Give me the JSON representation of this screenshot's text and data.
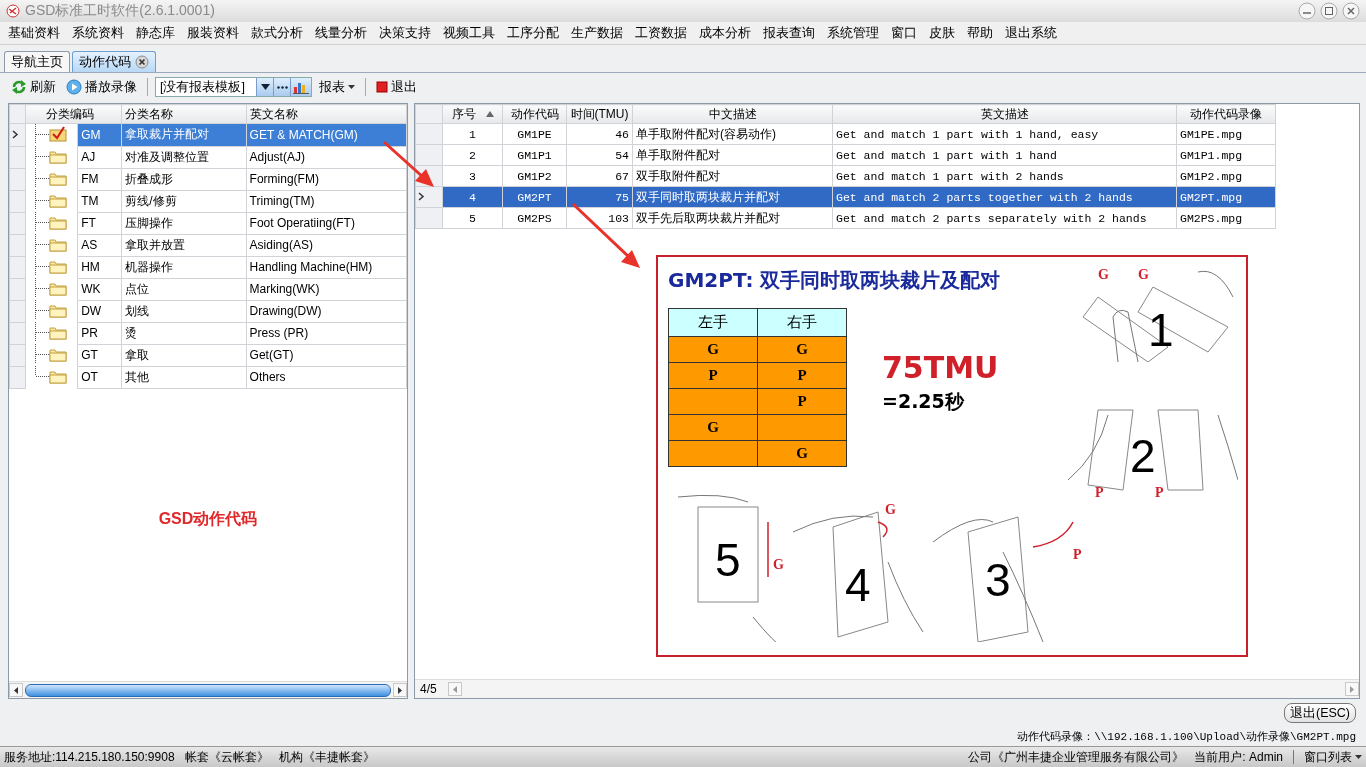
{
  "window": {
    "title": "GSD标准工时软件(2.6.1.0001)"
  },
  "menu": [
    "基础资料",
    "系统资料",
    "静态库",
    "服装资料",
    "款式分析",
    "线量分析",
    "决策支持",
    "视频工具",
    "工序分配",
    "生产数据",
    "工资数据",
    "成本分析",
    "报表查询",
    "系统管理",
    "窗口",
    "皮肤",
    "帮助",
    "退出系统"
  ],
  "tabs": [
    {
      "label": "导航主页",
      "selected": false,
      "closable": false
    },
    {
      "label": "动作代码",
      "selected": true,
      "closable": true
    }
  ],
  "toolbar": {
    "refresh": "刷新",
    "play": "播放录像",
    "template_combo": {
      "value": "[没有报表模板]"
    },
    "report_menu": "报表",
    "exit": "退出"
  },
  "category_grid": {
    "columns": [
      "分类编码",
      "分类名称",
      "英文名称"
    ],
    "rows": [
      {
        "kind": "checked",
        "code": "GM",
        "name": "拿取裁片并配对",
        "english": "GET & MATCH(GM)",
        "selected": true
      },
      {
        "kind": "folder",
        "code": "AJ",
        "name": "对准及调整位置",
        "english": "Adjust(AJ)",
        "selected": false
      },
      {
        "kind": "folder",
        "code": "FM",
        "name": "折叠成形",
        "english": "Forming(FM)",
        "selected": false
      },
      {
        "kind": "folder",
        "code": "TM",
        "name": "剪线/修剪",
        "english": "Triming(TM)",
        "selected": false
      },
      {
        "kind": "folder",
        "code": "FT",
        "name": "压脚操作",
        "english": "Foot Operatiing(FT)",
        "selected": false
      },
      {
        "kind": "folder",
        "code": "AS",
        "name": "拿取并放置",
        "english": "Asiding(AS)",
        "selected": false
      },
      {
        "kind": "folder",
        "code": "HM",
        "name": "机器操作",
        "english": "Handling Machine(HM)",
        "selected": false
      },
      {
        "kind": "folder",
        "code": "WK",
        "name": "点位",
        "english": "Marking(WK)",
        "selected": false
      },
      {
        "kind": "folder",
        "code": "DW",
        "name": "划线",
        "english": "Drawing(DW)",
        "selected": false
      },
      {
        "kind": "folder",
        "code": "PR",
        "name": "烫",
        "english": "Press (PR)",
        "selected": false
      },
      {
        "kind": "folder",
        "code": "GT",
        "name": "拿取",
        "english": "Get(GT)",
        "selected": false
      },
      {
        "kind": "folder",
        "code": "OT",
        "name": "其他",
        "english": "Others",
        "selected": false
      }
    ]
  },
  "panel_label": "GSD动作代码",
  "action_grid": {
    "columns": [
      {
        "label": "序号",
        "sorted": true
      },
      {
        "label": "动作代码",
        "sorted": false
      },
      {
        "label": "时间(TMU)",
        "sorted": false
      },
      {
        "label": "中文描述",
        "sorted": false
      },
      {
        "label": "英文描述",
        "sorted": false
      },
      {
        "label": "动作代码录像",
        "sorted": false
      }
    ],
    "rows": [
      {
        "no": "1",
        "code": "GM1PE",
        "time": "46",
        "chinese": "单手取附件配对(容易动作)",
        "english": "Get and match 1 part with 1 hand, easy",
        "video": "GM1PE.mpg",
        "selected": false
      },
      {
        "no": "2",
        "code": "GM1P1",
        "time": "54",
        "chinese": "单手取附件配对",
        "english": "Get and match 1 part with 1 hand",
        "video": "GM1P1.mpg",
        "selected": false
      },
      {
        "no": "3",
        "code": "GM1P2",
        "time": "67",
        "chinese": "双手取附件配对",
        "english": "Get and match 1 part with 2 hands",
        "video": "GM1P2.mpg",
        "selected": false
      },
      {
        "no": "4",
        "code": "GM2PT",
        "time": "75",
        "chinese": "双手同时取两块裁片并配对",
        "english": "Get and match 2 parts together with 2 hands",
        "video": "GM2PT.mpg",
        "selected": true
      },
      {
        "no": "5",
        "code": "GM2PS",
        "time": "103",
        "chinese": "双手先后取两块裁片并配对",
        "english": "Get and match 2 parts separately with 2 hands",
        "video": "GM2PS.mpg",
        "selected": false
      }
    ]
  },
  "slide": {
    "title": "GM2PT: 双手同时取两块裁片及配对",
    "table": {
      "columns": [
        "左手",
        "右手"
      ],
      "rows": [
        {
          "left": "G",
          "right": "G"
        },
        {
          "left": "P",
          "right": "P"
        },
        {
          "right": "P"
        },
        {
          "left": "G"
        },
        {
          "right": "G"
        }
      ]
    },
    "tmu": "75TMU",
    "seconds": "=2.25秒",
    "steps": [
      {
        "number": "1",
        "marks": [
          "G",
          "G"
        ]
      },
      {
        "number": "2",
        "marks": [
          "P",
          "P"
        ]
      },
      {
        "number": "5",
        "marks": [
          "G"
        ]
      },
      {
        "number": "4",
        "marks": [
          "G"
        ]
      },
      {
        "number": "3",
        "marks": [
          "P"
        ]
      }
    ]
  },
  "record_position": "4/5",
  "exit_esc_button": "退出(ESC)",
  "video_path": "动作代码录像：\\\\192.168.1.100\\Upload\\动作录像\\GM2PT.mpg",
  "status_bar": {
    "server": "服务地址:114.215.180.150:9908",
    "account": "帐套《云帐套》",
    "organization": "机构《丰捷帐套》",
    "company": "公司《广州丰捷企业管理服务有限公司》",
    "user": "当前用户: Admin",
    "window_list": "窗口列表"
  }
}
